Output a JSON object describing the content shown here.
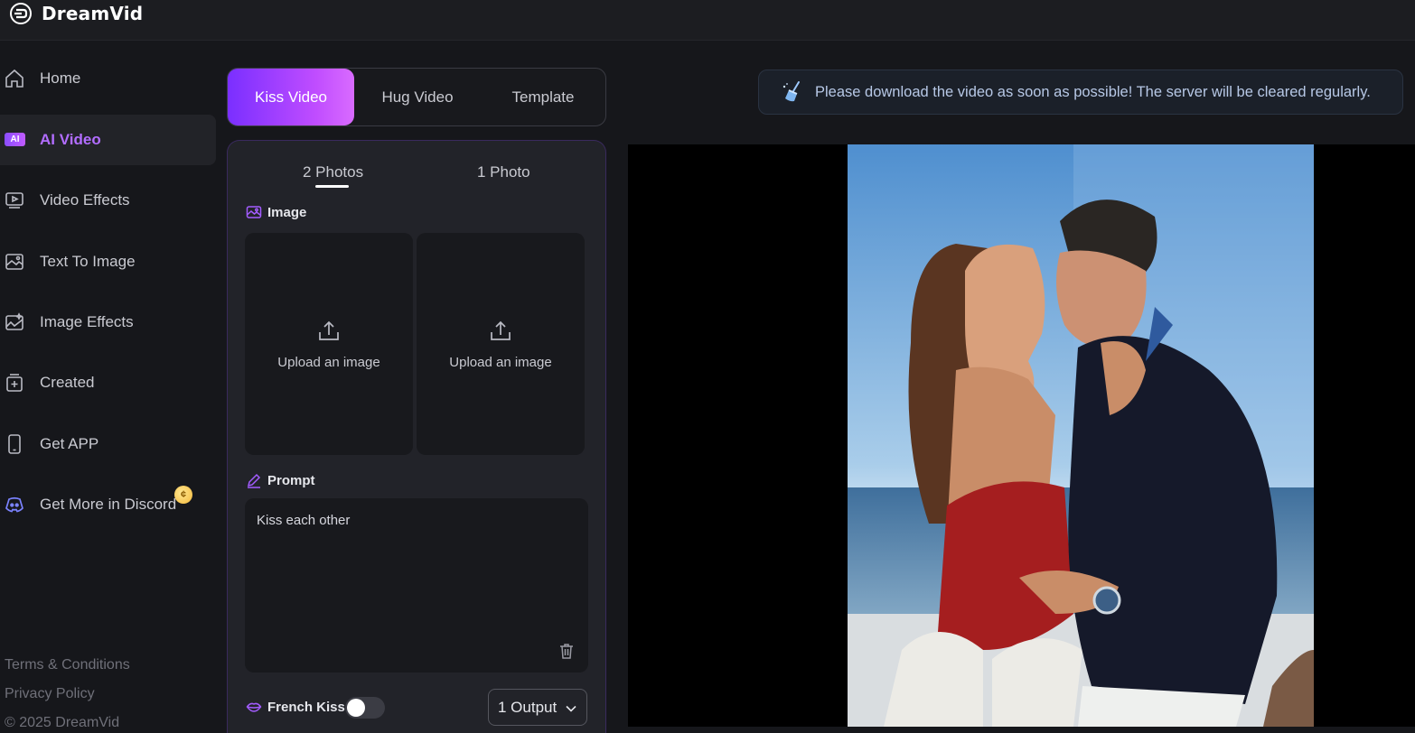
{
  "app": {
    "name": "DreamVid"
  },
  "sidebar": {
    "items": [
      {
        "label": "Home",
        "icon": "home-icon"
      },
      {
        "label": "AI Video",
        "icon": "ai-badge-icon",
        "badge": "AI",
        "active": true
      },
      {
        "label": "Video Effects",
        "icon": "video-effects-icon"
      },
      {
        "label": "Text To Image",
        "icon": "text-to-image-icon"
      },
      {
        "label": "Image Effects",
        "icon": "image-effects-icon"
      },
      {
        "label": "Created",
        "icon": "created-icon"
      },
      {
        "label": "Get APP",
        "icon": "phone-icon"
      },
      {
        "label": "Get More in Discord",
        "icon": "discord-icon"
      }
    ],
    "footer": {
      "terms": "Terms & Conditions",
      "privacy": "Privacy Policy",
      "copyright": "© 2025 DreamVid"
    }
  },
  "main_tabs": [
    {
      "label": "Kiss Video",
      "active": true
    },
    {
      "label": "Hug Video"
    },
    {
      "label": "Template"
    }
  ],
  "panel": {
    "subtabs": [
      {
        "label": "2 Photos",
        "active": true
      },
      {
        "label": "1 Photo"
      }
    ],
    "image_section": "Image",
    "upload_label": "Upload an image",
    "prompt_section": "Prompt",
    "prompt_value": "Kiss each other",
    "french_kiss_label": "French Kiss",
    "french_kiss_enabled": false,
    "output_select": "1 Output"
  },
  "notice": "Please download the video as soon as possible! The server will be cleared regularly.",
  "colors": {
    "accent": "#b26dff",
    "tab_gradient_start": "#7a2fff",
    "tab_gradient_end": "#d96bff",
    "background": "#16171b",
    "panel": "#222329"
  }
}
